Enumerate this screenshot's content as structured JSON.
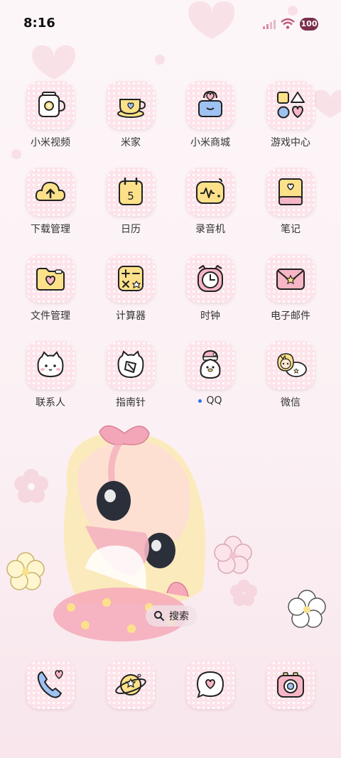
{
  "status_bar": {
    "time": "8:16",
    "battery": "100"
  },
  "apps": [
    {
      "label": "小米视频"
    },
    {
      "label": "米家"
    },
    {
      "label": "小米商城"
    },
    {
      "label": "游戏中心"
    },
    {
      "label": "下载管理"
    },
    {
      "label": "日历"
    },
    {
      "label": "录音机"
    },
    {
      "label": "笔记"
    },
    {
      "label": "文件管理"
    },
    {
      "label": "计算器"
    },
    {
      "label": "时钟"
    },
    {
      "label": "电子邮件"
    },
    {
      "label": "联系人"
    },
    {
      "label": "指南针"
    },
    {
      "label": "QQ"
    },
    {
      "label": "微信"
    }
  ],
  "calendar_day": "5",
  "search": {
    "label": "搜索"
  },
  "colors": {
    "tile_bg": "#fde3ea",
    "accent_yellow": "#fce18a",
    "accent_pink": "#f6b6c6",
    "accent_blue": "#9ec3f2"
  }
}
